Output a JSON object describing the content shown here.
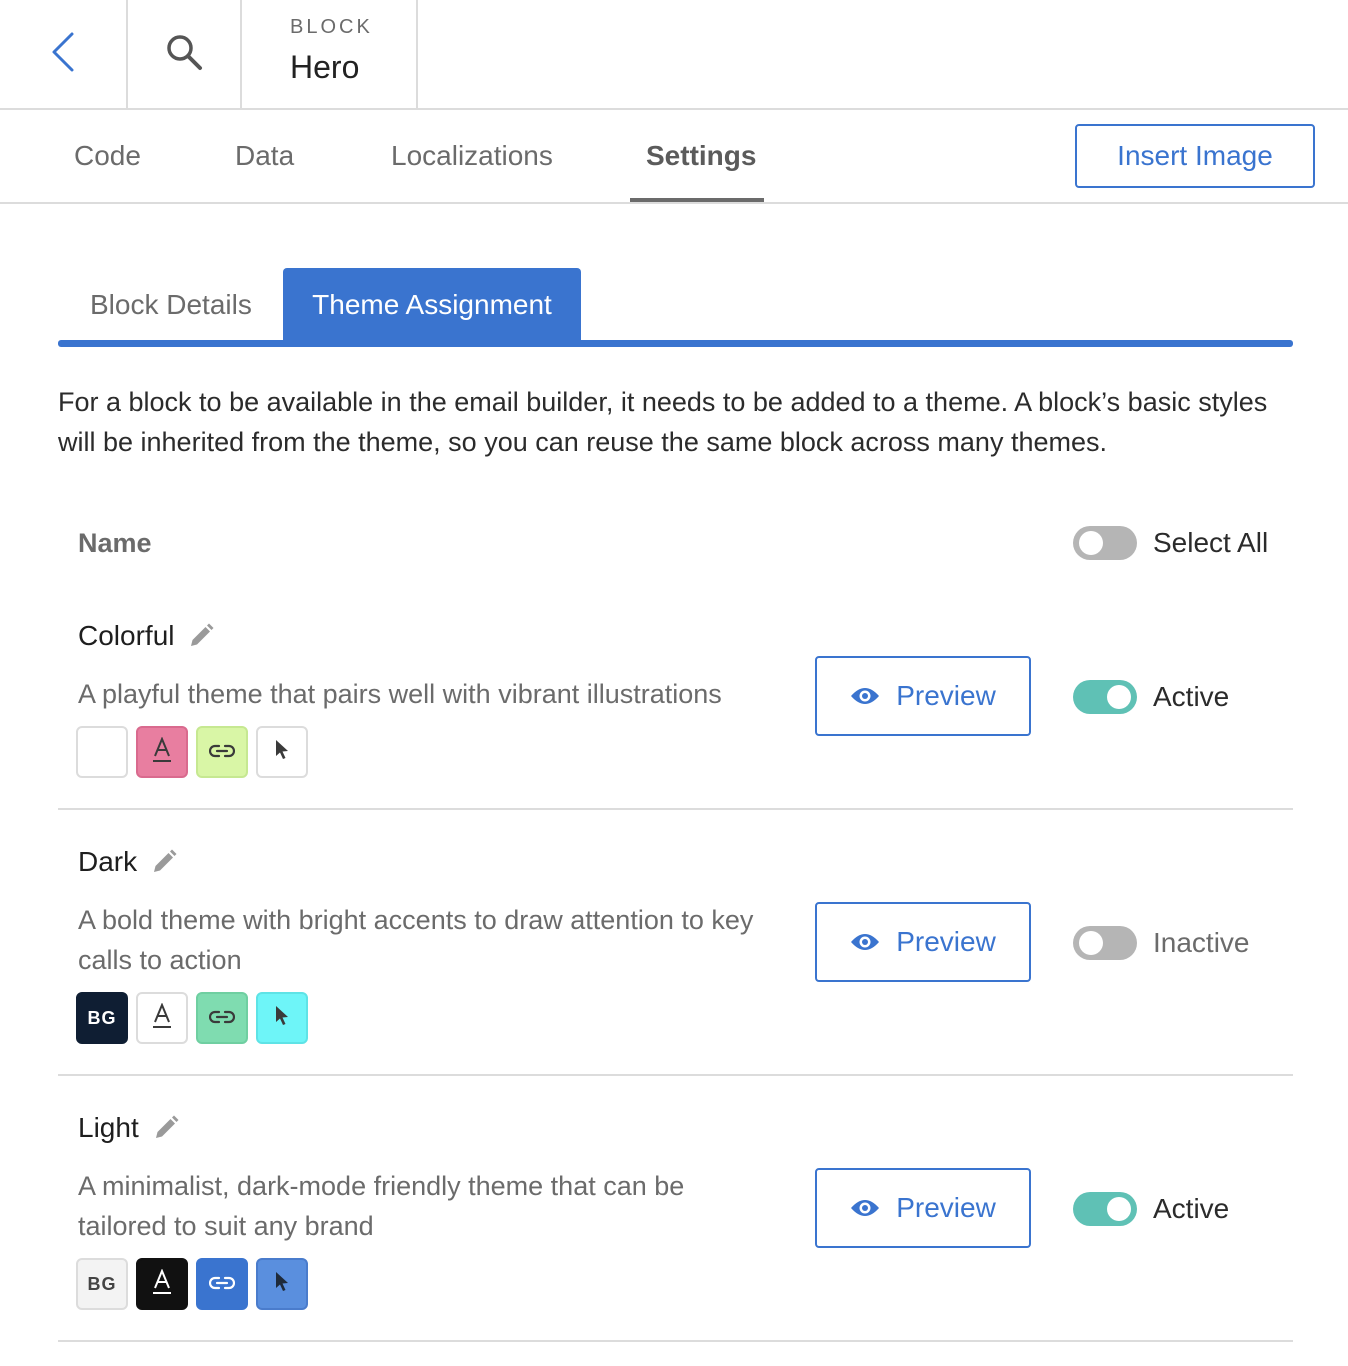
{
  "header": {
    "eyebrow": "BLOCK",
    "title": "Hero"
  },
  "tabs": [
    {
      "label": "Code"
    },
    {
      "label": "Data"
    },
    {
      "label": "Localizations"
    },
    {
      "label": "Settings",
      "active": true
    }
  ],
  "insert_image_label": "Insert Image",
  "subtabs": {
    "details": "Block Details",
    "theme": "Theme Assignment"
  },
  "intro": "For a block to be available in the email builder, it needs to be added to a theme. A block’s basic styles will be inherited from the theme, so you can reuse the same block across many themes.",
  "list": {
    "name_header": "Name",
    "select_all_label": "Select All",
    "select_all_on": false
  },
  "preview_label": "Preview",
  "colors": {
    "accent": "#3a74cf",
    "toggle_on": "#5fc1b5",
    "toggle_off": "#b5b5b5"
  },
  "themes": [
    {
      "name": "Colorful",
      "description": "A playful theme that pairs well with vibrant illustrations",
      "status": "Active",
      "active": true,
      "swatches": {
        "bg": {
          "color": "#ffffff",
          "text": ""
        },
        "text": {
          "color": "#e87ea0",
          "icon": "text-color-icon"
        },
        "link": {
          "color": "#d9f6a6",
          "icon": "link-icon"
        },
        "button": {
          "color": "#ffffff",
          "icon": "cursor-icon"
        }
      }
    },
    {
      "name": "Dark",
      "description": "A bold theme with bright accents to draw attention to key calls to action",
      "status": "Inactive",
      "active": false,
      "swatches": {
        "bg": {
          "color": "#0f1e33",
          "text": "BG"
        },
        "text": {
          "color": "#ffffff",
          "icon": "text-color-icon"
        },
        "link": {
          "color": "#7fdcb0",
          "icon": "link-icon"
        },
        "button": {
          "color": "#6ef5f8",
          "icon": "cursor-icon"
        }
      }
    },
    {
      "name": "Light",
      "description": "A minimalist, dark-mode friendly theme that can be tailored to suit any brand",
      "status": "Active",
      "active": true,
      "swatches": {
        "bg": {
          "color": "#f3f3f3",
          "text": "BG"
        },
        "text": {
          "color": "#111111",
          "icon": "text-color-icon"
        },
        "link": {
          "color": "#3a74cf",
          "icon": "link-icon"
        },
        "button": {
          "color": "#5a8fde",
          "icon": "cursor-icon"
        }
      }
    }
  ]
}
